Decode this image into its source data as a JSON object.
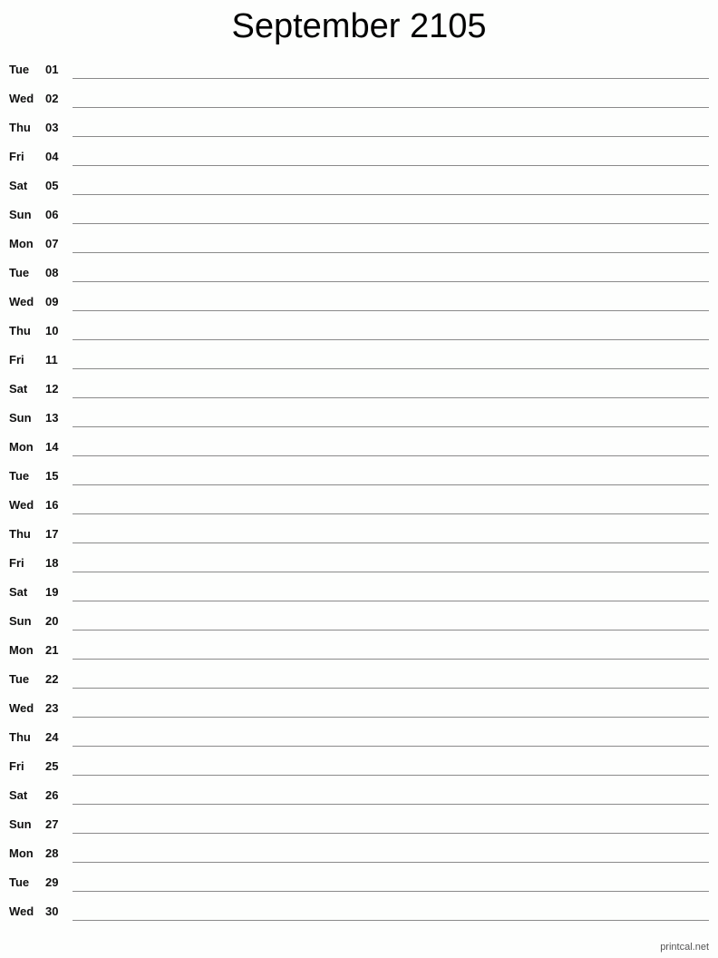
{
  "title": "September 2105",
  "days": [
    {
      "dow": "Tue",
      "day": "01"
    },
    {
      "dow": "Wed",
      "day": "02"
    },
    {
      "dow": "Thu",
      "day": "03"
    },
    {
      "dow": "Fri",
      "day": "04"
    },
    {
      "dow": "Sat",
      "day": "05"
    },
    {
      "dow": "Sun",
      "day": "06"
    },
    {
      "dow": "Mon",
      "day": "07"
    },
    {
      "dow": "Tue",
      "day": "08"
    },
    {
      "dow": "Wed",
      "day": "09"
    },
    {
      "dow": "Thu",
      "day": "10"
    },
    {
      "dow": "Fri",
      "day": "11"
    },
    {
      "dow": "Sat",
      "day": "12"
    },
    {
      "dow": "Sun",
      "day": "13"
    },
    {
      "dow": "Mon",
      "day": "14"
    },
    {
      "dow": "Tue",
      "day": "15"
    },
    {
      "dow": "Wed",
      "day": "16"
    },
    {
      "dow": "Thu",
      "day": "17"
    },
    {
      "dow": "Fri",
      "day": "18"
    },
    {
      "dow": "Sat",
      "day": "19"
    },
    {
      "dow": "Sun",
      "day": "20"
    },
    {
      "dow": "Mon",
      "day": "21"
    },
    {
      "dow": "Tue",
      "day": "22"
    },
    {
      "dow": "Wed",
      "day": "23"
    },
    {
      "dow": "Thu",
      "day": "24"
    },
    {
      "dow": "Fri",
      "day": "25"
    },
    {
      "dow": "Sat",
      "day": "26"
    },
    {
      "dow": "Sun",
      "day": "27"
    },
    {
      "dow": "Mon",
      "day": "28"
    },
    {
      "dow": "Tue",
      "day": "29"
    },
    {
      "dow": "Wed",
      "day": "30"
    }
  ],
  "footer": "printcal.net"
}
